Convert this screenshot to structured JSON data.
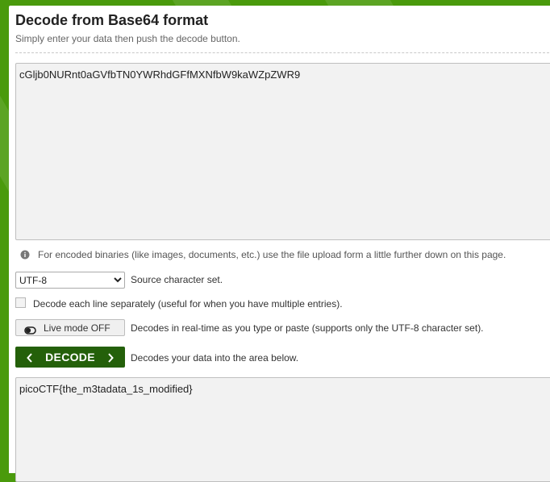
{
  "page": {
    "title": "Decode from Base64 format",
    "subtitle": "Simply enter your data then push the decode button."
  },
  "input": {
    "value": "cGljb0NURnt0aGVfbTN0YWRhdGFfMXNfbW9kaWZpZWR9"
  },
  "info": {
    "icon": "info-icon",
    "text": "For encoded binaries (like images, documents, etc.) use the file upload form a little further down on this page."
  },
  "charset": {
    "selected": "UTF-8",
    "label": "Source character set."
  },
  "options": {
    "separate_lines_label": "Decode each line separately (useful for when you have multiple entries).",
    "separate_lines_checked": false
  },
  "live_mode": {
    "icon": "toggle-off-icon",
    "label": "Live mode OFF",
    "description": "Decodes in real-time as you type or paste (supports only the UTF-8 character set)."
  },
  "decode": {
    "label": "DECODE",
    "description": "Decodes your data into the area below."
  },
  "output": {
    "value": "picoCTF{the_m3tadata_1s_modified}"
  },
  "colors": {
    "background_green": "#4a9a0c",
    "button_green": "#24600a",
    "textarea_bg": "#f2f2f2"
  }
}
